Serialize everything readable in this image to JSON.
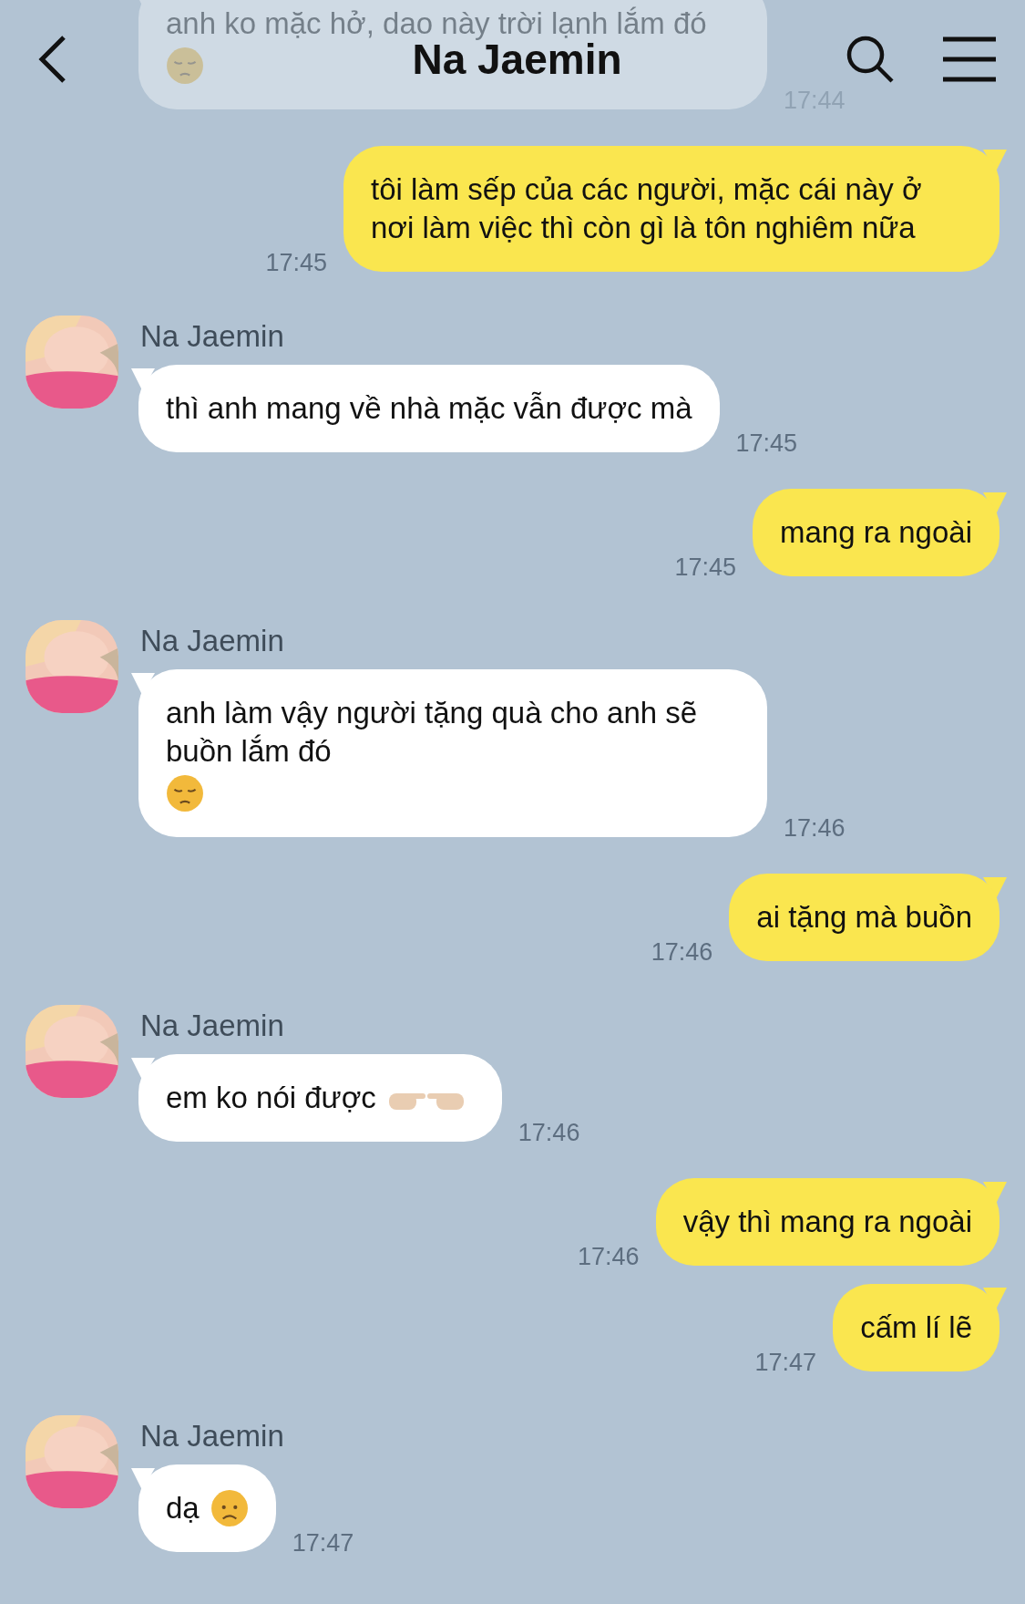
{
  "header": {
    "title": "Na Jaemin"
  },
  "messages": [
    {
      "kind": "received",
      "text": "anh ko mặc hở, dao này trời lạnh lắm đó",
      "emoji": {
        "kind": "pensive"
      },
      "time": "17:44"
    },
    {
      "kind": "sent",
      "text": "tôi làm sếp của các người, mặc cái này ở nơi làm việc thì còn gì là tôn nghiêm nữa",
      "time": "17:45"
    },
    {
      "kind": "received",
      "sender": "Na Jaemin",
      "text": "thì anh mang về nhà mặc vẫn được mà",
      "time": "17:45"
    },
    {
      "kind": "sent",
      "text": "mang ra ngoài",
      "time": "17:45"
    },
    {
      "kind": "received",
      "sender": "Na Jaemin",
      "text": "anh làm vậy người tặng quà cho anh sẽ buồn lắm đó",
      "emoji": {
        "kind": "pensive"
      },
      "time": "17:46"
    },
    {
      "kind": "sent",
      "text": "ai tặng mà buồn",
      "time": "17:46"
    },
    {
      "kind": "received",
      "sender": "Na Jaemin",
      "text": "em ko nói được",
      "emoji": {
        "kind": "pointing"
      },
      "time": "17:46"
    },
    {
      "kind": "sent",
      "text": "vậy thì mang ra ngoài",
      "time": "17:46"
    },
    {
      "kind": "sent",
      "text": "cấm lí lẽ",
      "time": "17:47"
    },
    {
      "kind": "received",
      "sender": "Na Jaemin",
      "text": "dạ",
      "emoji": {
        "kind": "disappointed"
      },
      "time": "17:47"
    }
  ]
}
